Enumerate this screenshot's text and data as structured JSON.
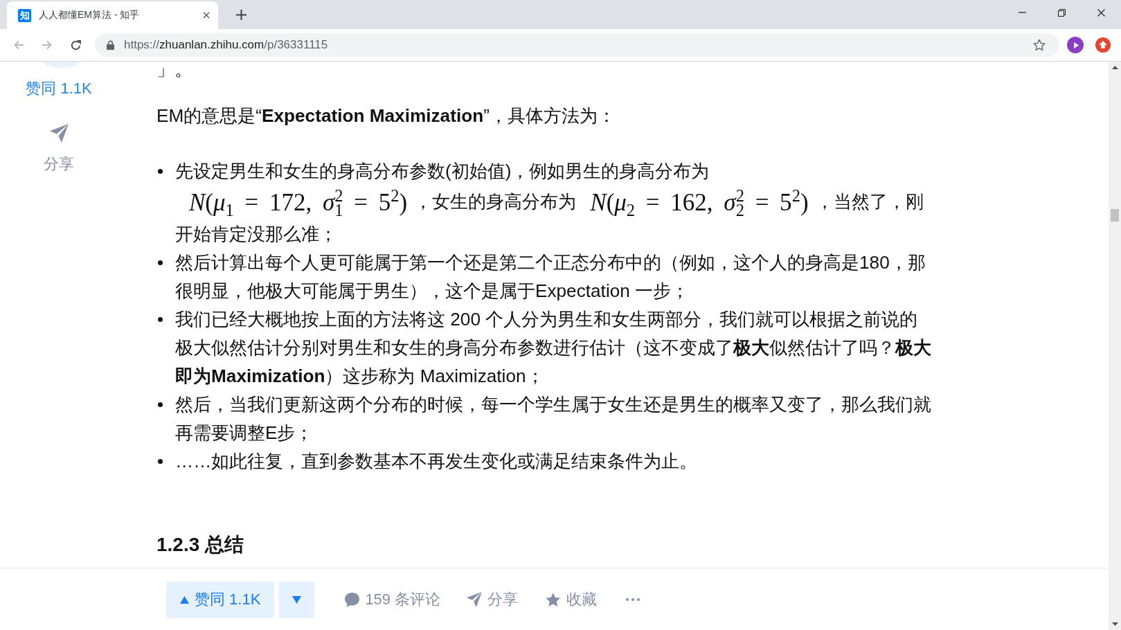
{
  "tabs": [
    {
      "icon_text": "知",
      "title": "人人都懂EM算法 - 知乎",
      "selected": true
    }
  ],
  "toolbar": {
    "back_disabled": true,
    "forward_disabled": true
  },
  "address_bar": {
    "scheme": "https://",
    "host": "zhuanlan.zhihu.com",
    "path": "/p/36331115"
  },
  "sidebar": {
    "vote_label": "赞同 1.1K",
    "share_label": "分享"
  },
  "article": {
    "fragment": "」。",
    "intro": "EM的意思是“**Expectation Maximization**”，具体方法为：",
    "steps": [
      {
        "parts": [
          {
            "kind": "text",
            "text": "先设定男生和女生的身高分布参数(初始值)，例如男生的身高分布为"
          },
          {
            "kind": "math",
            "text": "*N*(*μ*$_{1}$ = 172, *σ*$^{2}$$_{1}$ = 5$^{2}$)"
          },
          {
            "kind": "text",
            "text": "，女生的身高分布为"
          },
          {
            "kind": "math",
            "text": "*N*(*μ*$_{2}$ = 162, *σ*$^{2}$$_{2}$ = 5$^{2}$)"
          },
          {
            "kind": "text",
            "text": "，当然了，刚开始肯定没那么准；"
          }
        ]
      },
      {
        "parts": [
          {
            "kind": "text",
            "text": "然后计算出每个人更可能属于第一个还是第二个正态分布中的（例如，这个人的身高是180，那很明显，他极大可能属于男生），这个是属于Expectation 一步；"
          }
        ]
      },
      {
        "parts": [
          {
            "kind": "text",
            "text": "我们已经大概地按上面的方法将这 200 个人分为男生和女生两部分，我们就可以根据之前说的极大似然估计分别对男生和女生的身高分布参数进行估计（这不变成了**极大**似然估计了吗？**极大即为Maximization**）这步称为 Maximization；"
          }
        ]
      },
      {
        "parts": [
          {
            "kind": "text",
            "text": "然后，当我们更新这两个分布的时候，每一个学生属于女生还是男生的概率又变了，那么我们就再需要调整E步；"
          }
        ]
      },
      {
        "parts": [
          {
            "kind": "text",
            "text": "……如此往复，直到参数基本不再发生变化或满足结束条件为止。"
          }
        ]
      }
    ],
    "heading": "1.2.3 总结"
  },
  "action_bar": {
    "upvote_label": "赞同 1.1K",
    "comments_label": "159 条评论",
    "share_label": "分享",
    "collect_label": "收藏"
  }
}
